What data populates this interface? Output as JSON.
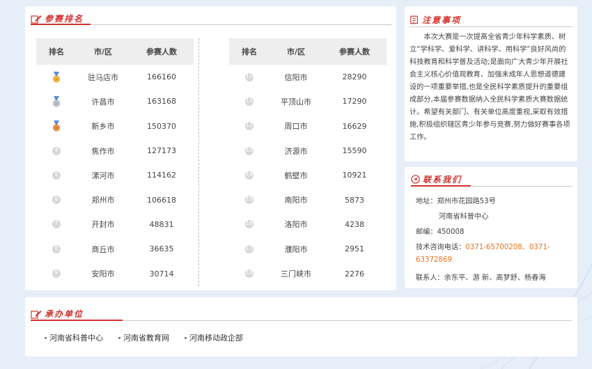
{
  "ranking": {
    "title": "参赛排名",
    "headers": {
      "rank": "排名",
      "city": "市/区",
      "count": "参赛人数"
    },
    "left": [
      {
        "rank": "1",
        "medal": "gold",
        "city": "驻马店市",
        "count": "166160"
      },
      {
        "rank": "2",
        "medal": "silver",
        "city": "许昌市",
        "count": "163168"
      },
      {
        "rank": "3",
        "medal": "bronze",
        "city": "新乡市",
        "count": "150370"
      },
      {
        "rank": "4",
        "city": "焦作市",
        "count": "127173"
      },
      {
        "rank": "5",
        "city": "漯河市",
        "count": "114162"
      },
      {
        "rank": "6",
        "city": "郑州市",
        "count": "106618"
      },
      {
        "rank": "7",
        "city": "开封市",
        "count": "48831"
      },
      {
        "rank": "8",
        "city": "商丘市",
        "count": "36635"
      },
      {
        "rank": "9",
        "city": "安阳市",
        "count": "30714"
      }
    ],
    "right": [
      {
        "rank": "10",
        "city": "信阳市",
        "count": "28290"
      },
      {
        "rank": "11",
        "city": "平顶山市",
        "count": "17290"
      },
      {
        "rank": "12",
        "city": "周口市",
        "count": "16629"
      },
      {
        "rank": "13",
        "city": "济源市",
        "count": "15590"
      },
      {
        "rank": "14",
        "city": "鹤壁市",
        "count": "10921"
      },
      {
        "rank": "15",
        "city": "南阳市",
        "count": "5873"
      },
      {
        "rank": "16",
        "city": "洛阳市",
        "count": "4238"
      },
      {
        "rank": "17",
        "city": "濮阳市",
        "count": "2951"
      },
      {
        "rank": "18",
        "city": "三门峡市",
        "count": "2276"
      }
    ]
  },
  "notice": {
    "title": "注意事项",
    "text": "本次大赛是一次提高全省青少年科学素质、树立“学科学、爱科学、讲科学、用科学”良好风尚的科技教育和科学普及活动;是面向广大青少年开展社会主义核心价值观教育、加强未成年人思想道德建设的一项重要举措,也是全民科学素质提升的重要组成部分,本届参赛数据纳入全民科学素质大赛数据统计。希望有关部门、有关单位高度重视,采取有效措施,积极组织辖区青少年参与竞赛,努力做好赛事各项工作。"
  },
  "contact": {
    "title": "联系我们",
    "address_label": "地址：",
    "address_line1": "郑州市花园路53号",
    "address_line2": "河南省科普中心",
    "postcode_label": "邮编：",
    "postcode": "450008",
    "phone_label": "技术咨询电话：",
    "phone_part1": "0371-65700208、0371-",
    "phone_part2": "63372869",
    "contacts_label": "联系人：",
    "contacts": "余东平、游 新、高梦舒、杨春海"
  },
  "organizers": {
    "title": "承办单位",
    "items": [
      "河南省科普中心",
      "河南省教育网",
      "河南移动政企部"
    ]
  },
  "colors": {
    "accent_red": "#d2322d",
    "accent_orange": "#e8721c",
    "background": "#e6eef8",
    "gold": "#e8a21b",
    "silver": "#a9b4c2",
    "bronze": "#e07b22"
  }
}
